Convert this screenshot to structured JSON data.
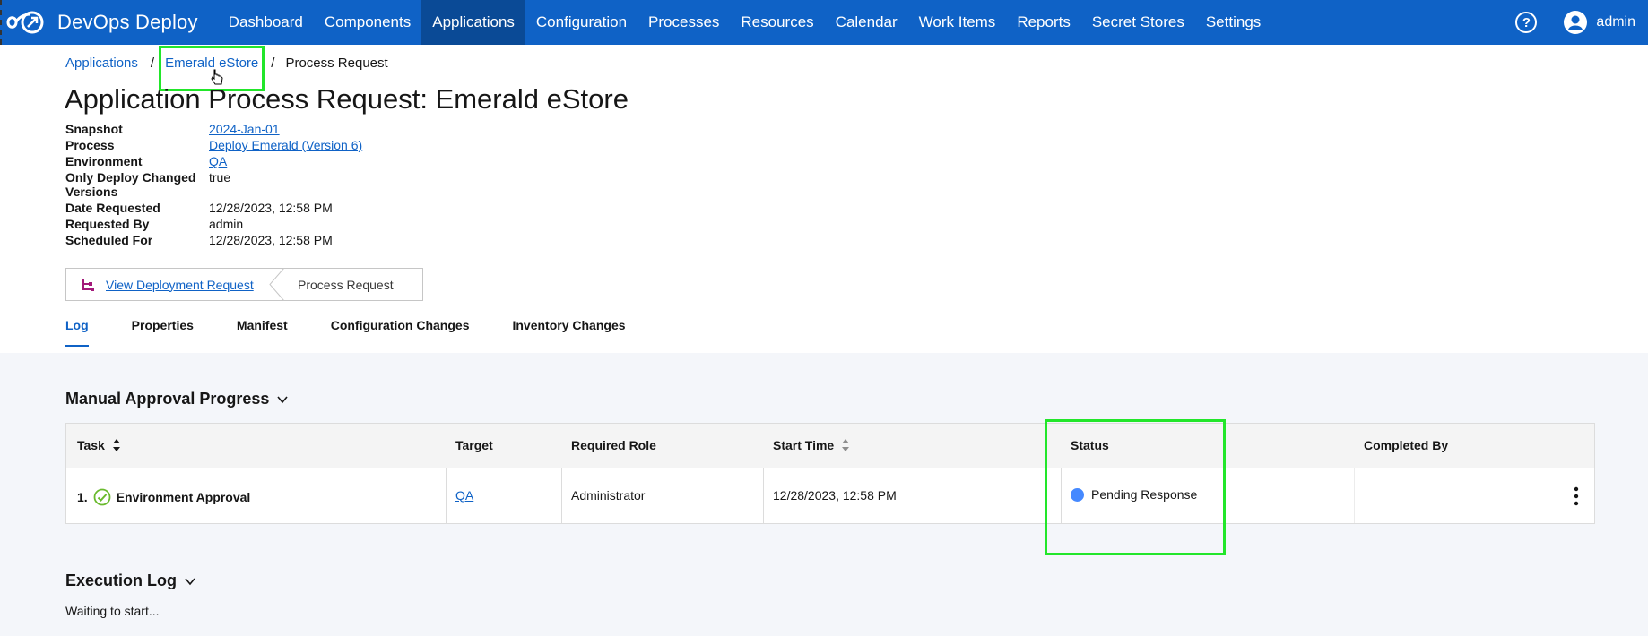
{
  "app": {
    "name": "DevOps Deploy"
  },
  "nav": {
    "items": [
      {
        "label": "Dashboard"
      },
      {
        "label": "Components"
      },
      {
        "label": "Applications"
      },
      {
        "label": "Configuration"
      },
      {
        "label": "Processes"
      },
      {
        "label": "Resources"
      },
      {
        "label": "Calendar"
      },
      {
        "label": "Work Items"
      },
      {
        "label": "Reports"
      },
      {
        "label": "Secret Stores"
      },
      {
        "label": "Settings"
      }
    ],
    "active": "Applications",
    "help_glyph": "?",
    "user": "admin"
  },
  "breadcrumb": {
    "items": [
      {
        "label": "Applications"
      },
      {
        "label": "Emerald eStore"
      },
      {
        "label": "Process Request"
      }
    ],
    "sep": "/"
  },
  "page_title": "Application Process Request: Emerald eStore",
  "details": [
    {
      "label": "Snapshot",
      "value": "2024-Jan-01"
    },
    {
      "label": "Process",
      "value": "Deploy Emerald (Version 6)"
    },
    {
      "label": "Environment",
      "value": "QA"
    },
    {
      "label": "Only Deploy Changed Versions",
      "value": "true"
    },
    {
      "label": "Date Requested",
      "value": "12/28/2023, 12:58 PM"
    },
    {
      "label": "Requested By",
      "value": "admin"
    },
    {
      "label": "Scheduled For",
      "value": "12/28/2023, 12:58 PM"
    }
  ],
  "request_strip": {
    "link": "View Deployment Request",
    "current": "Process Request"
  },
  "tabs": [
    {
      "label": "Log"
    },
    {
      "label": "Properties"
    },
    {
      "label": "Manifest"
    },
    {
      "label": "Configuration Changes"
    },
    {
      "label": "Inventory Changes"
    }
  ],
  "manual_approval": {
    "title": "Manual Approval Progress",
    "columns": {
      "task": "Task",
      "target": "Target",
      "role": "Required Role",
      "start": "Start Time",
      "status": "Status",
      "completed_by": "Completed By"
    },
    "rows": [
      {
        "index": "1.",
        "task": "Environment Approval",
        "target": "QA",
        "role": "Administrator",
        "start": "12/28/2023, 12:58 PM",
        "status": "Pending Response",
        "completed_by": ""
      }
    ]
  },
  "execution_log": {
    "title": "Execution Log",
    "text": "Waiting to start..."
  },
  "colors": {
    "nav_bg": "#0f62c6",
    "nav_active": "#0a4a96",
    "link": "#0f62c6",
    "highlight": "#22e62a",
    "status_pending": "#4589ff",
    "check": "#6aba2e"
  }
}
